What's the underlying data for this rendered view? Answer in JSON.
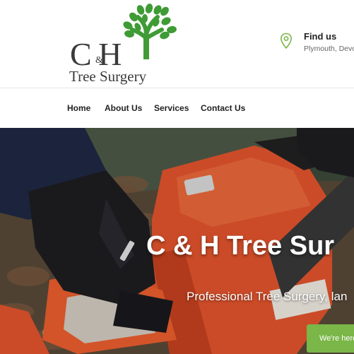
{
  "logo": {
    "initials": "C H",
    "ampersand": "&",
    "subtitle": "Tree Surgery",
    "brand_green": "#3f9b35",
    "icon": "tree-logo-icon"
  },
  "contact": {
    "title": "Find us",
    "location": "Plymouth, Devo",
    "icon": "map-pin-icon",
    "accent": "#7ab648"
  },
  "nav": {
    "items": [
      {
        "label": "Home"
      },
      {
        "label": "About Us"
      },
      {
        "label": "Services"
      },
      {
        "label": "Contact Us"
      }
    ]
  },
  "hero": {
    "title": "C & H Tree Sur",
    "subtitle": "Professional Tree Surgery, lan",
    "cta_label": "We're here",
    "cta_color": "#7ab648"
  }
}
